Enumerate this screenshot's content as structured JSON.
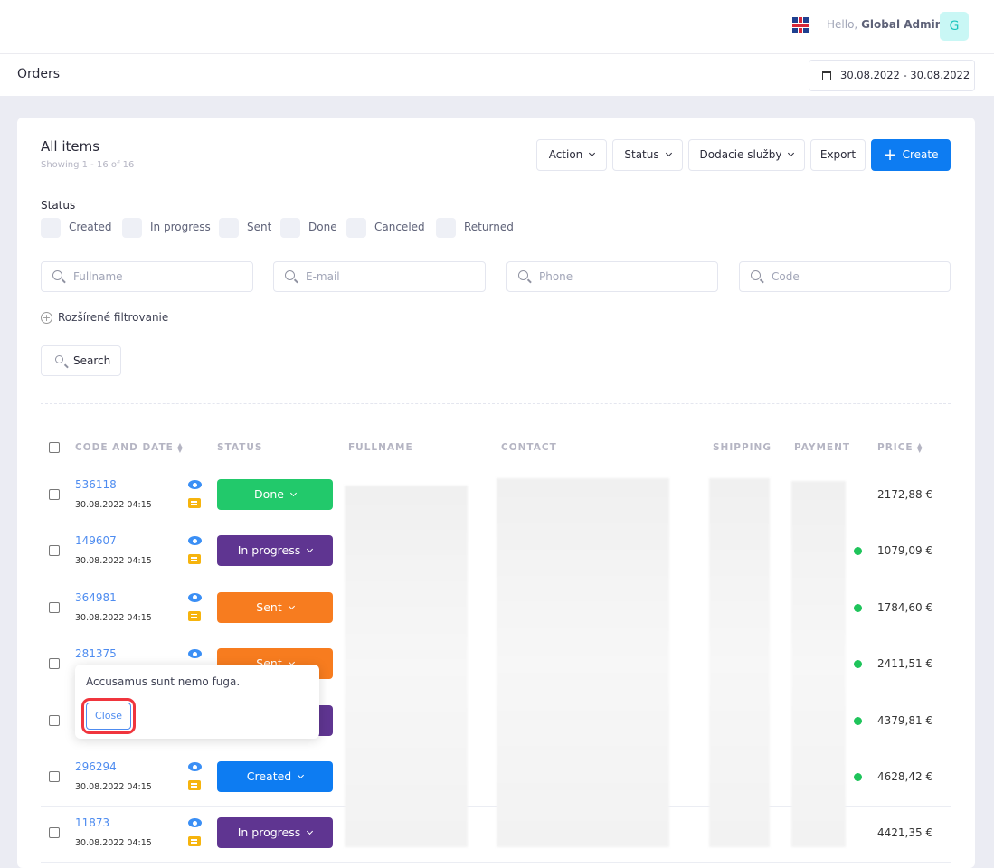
{
  "header": {
    "greeting": "Hello,",
    "user_name": "Global Admin",
    "avatar_letter": "G",
    "language_icon": "uk-flag-icon"
  },
  "page": {
    "title": "Orders",
    "date_range": "30.08.2022 - 30.08.2022"
  },
  "card": {
    "title": "All items",
    "showing": "Showing 1 - 16 of 16"
  },
  "toolbar": {
    "action": "Action",
    "status": "Status",
    "shipping": "Dodacie služby",
    "export": "Export",
    "create": "Create"
  },
  "filters": {
    "status_label": "Status",
    "statuses": [
      "Created",
      "In progress",
      "Sent",
      "Done",
      "Canceled",
      "Returned"
    ],
    "placeholders": {
      "fullname": "Fullname",
      "email": "E-mail",
      "phone": "Phone",
      "code": "Code"
    },
    "advanced": "Rozšírené filtrovanie",
    "search": "Search"
  },
  "table": {
    "headers": {
      "code": "CODE AND DATE",
      "status": "STATUS",
      "fullname": "FULLNAME",
      "contact": "CONTACT",
      "shipping": "SHIPPING",
      "payment": "PAYMENT",
      "price": "PRICE"
    },
    "rows": [
      {
        "code": "536118",
        "date": "30.08.2022 04:15",
        "status": "Done",
        "color": "#22c96b",
        "price": "2172,88 €",
        "paid": false
      },
      {
        "code": "149607",
        "date": "30.08.2022 04:15",
        "status": "In progress",
        "color": "#5f3591",
        "price": "1079,09 €",
        "paid": true
      },
      {
        "code": "364981",
        "date": "30.08.2022 04:15",
        "status": "Sent",
        "color": "#f77c1f",
        "price": "1784,60 €",
        "paid": true
      },
      {
        "code": "281375",
        "date": "",
        "status": "Sent",
        "color": "#f77c1f",
        "price": "2411,51 €",
        "paid": true
      },
      {
        "code": "",
        "date": "",
        "status": "In progress",
        "color": "#5f3591",
        "price": "4379,81 €",
        "paid": true
      },
      {
        "code": "296294",
        "date": "30.08.2022 04:15",
        "status": "Created",
        "color": "#0d7cf2",
        "price": "4628,42 €",
        "paid": true
      },
      {
        "code": "11873",
        "date": "30.08.2022 04:15",
        "status": "In progress",
        "color": "#5f3591",
        "price": "4421,35 €",
        "paid": false
      }
    ]
  },
  "popover": {
    "text": "Accusamus sunt nemo fuga.",
    "close": "Close"
  }
}
